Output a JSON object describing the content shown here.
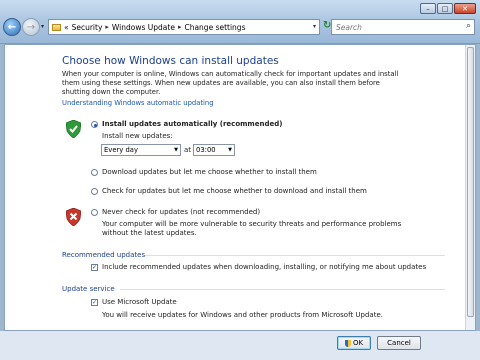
{
  "window": {
    "buttons": {
      "minimize": "–",
      "maximize": "□",
      "close": "✕"
    }
  },
  "nav": {
    "back_glyph": "←",
    "forward_glyph": "→",
    "dropdown_glyph": "▾",
    "breadcrumb": [
      "«",
      "Security",
      "Windows Update",
      "Change settings"
    ],
    "breadcrumb_sep": "▸",
    "refresh_glyph": "↻",
    "search_placeholder": "Search"
  },
  "page": {
    "title": "Choose how Windows can install updates",
    "intro": "When your computer is online, Windows can automatically check for important updates and install them using these settings. When new updates are available, you can also install them before shutting down the computer.",
    "link": "Understanding Windows automatic updating"
  },
  "options": {
    "auto": {
      "label": "Install updates automatically (recommended)",
      "underline_char": "I",
      "sub_label": "Install new updates:",
      "day": "Every day",
      "at": "at",
      "time": "03:00",
      "checked": true
    },
    "download": {
      "label": "Download updates but let me choose whether to install them",
      "checked": false
    },
    "check": {
      "label": "Check for updates but let me choose whether to download and install them",
      "checked": false
    },
    "never": {
      "label": "Never check for updates (not recommended)",
      "note": "Your computer will be more vulnerable to security threats and performance problems without the latest updates.",
      "checked": false
    }
  },
  "recommended": {
    "heading": "Recommended updates",
    "checkbox_label": "Include recommended updates when downloading, installing, or notifying me about updates",
    "checked": true
  },
  "update_service": {
    "heading": "Update service",
    "checkbox_label": "Use Microsoft Update",
    "note": "You will receive updates for Windows and other products from Microsoft Update.",
    "checked": true
  },
  "footer": {
    "ok_label": "OK",
    "cancel_label": "Cancel"
  },
  "colors": {
    "heading_blue": "#1c3f8f",
    "link_blue": "#1a56b8",
    "shield_green": "#2f9a3a",
    "shield_red": "#c8352b"
  }
}
